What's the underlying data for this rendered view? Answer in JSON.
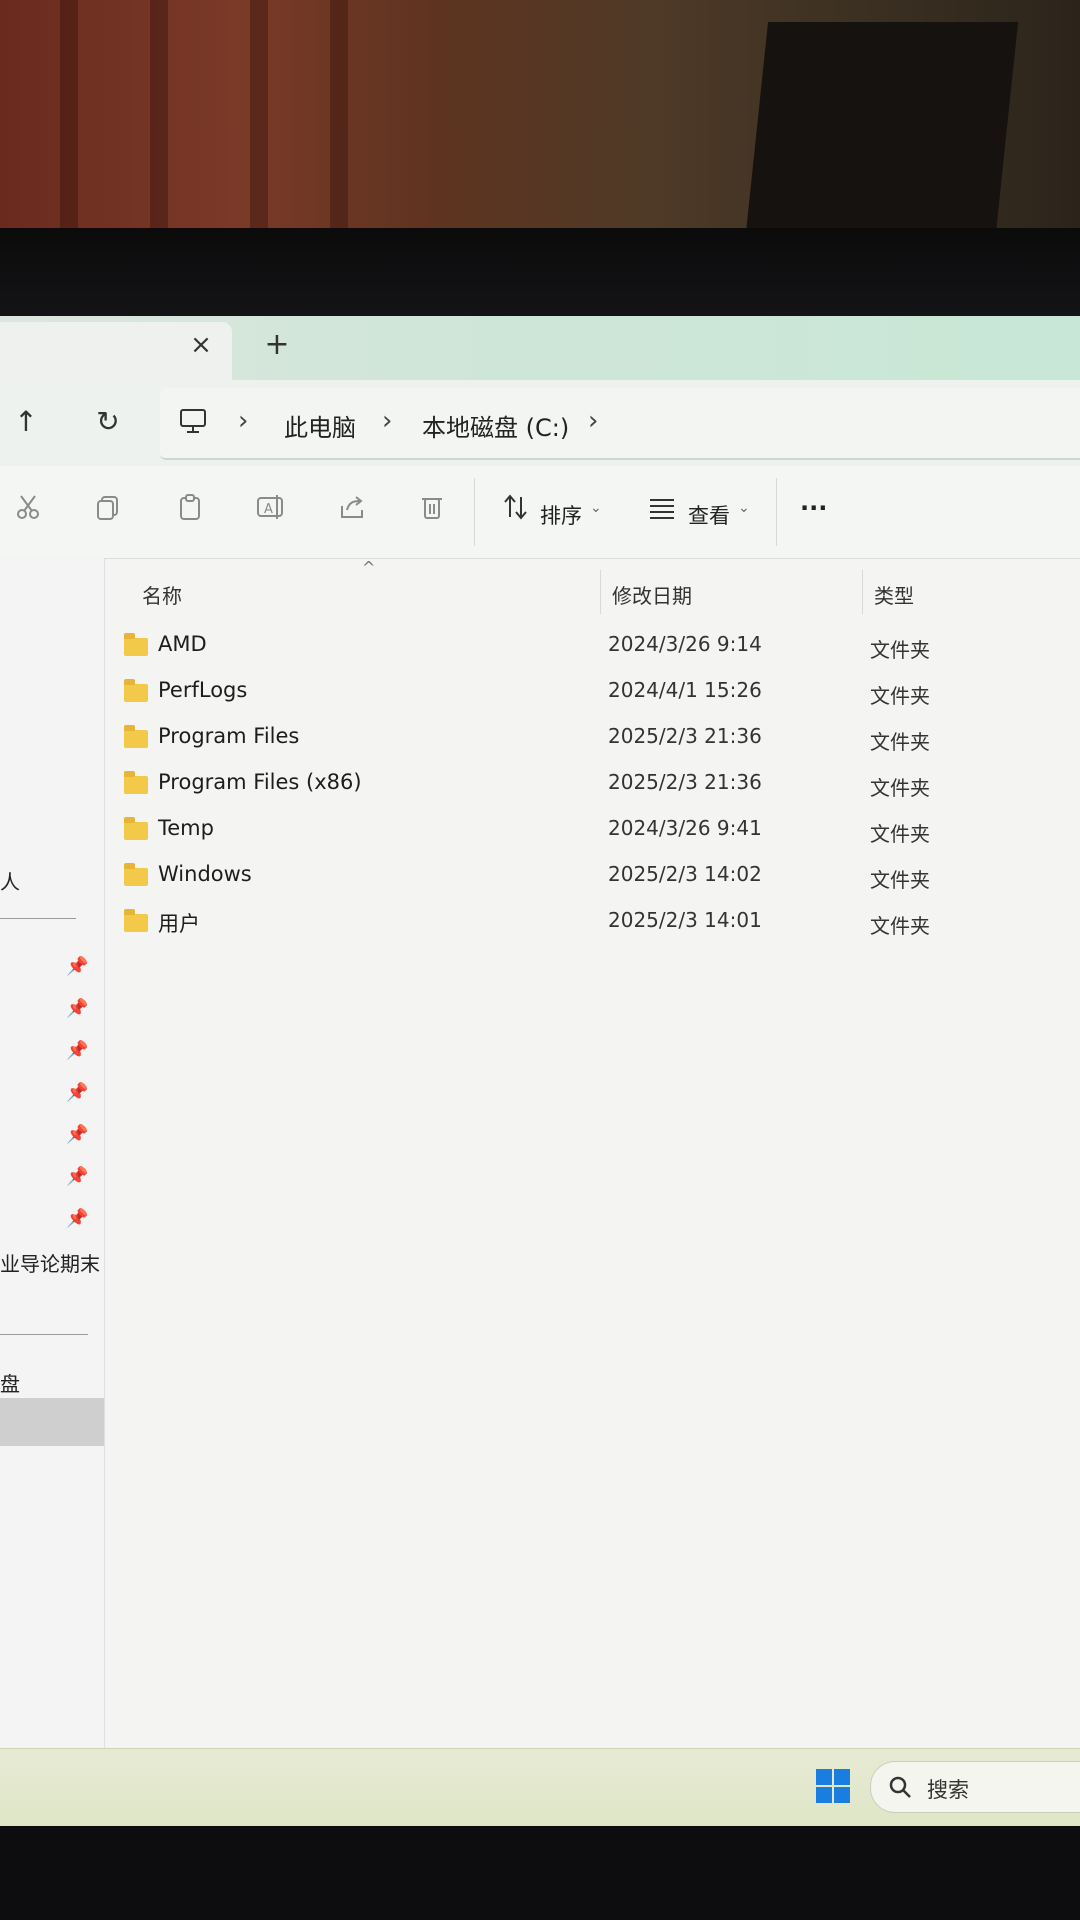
{
  "tabs": {
    "close_glyph": "×",
    "new_glyph": "+"
  },
  "nav": {
    "up_glyph": "↑",
    "refresh_glyph": "↻",
    "breadcrumbs": [
      "此电脑",
      "本地磁盘 (C:)"
    ],
    "separator": "›"
  },
  "toolbar": {
    "sort_label": "排序",
    "view_label": "查看",
    "more_label": "···",
    "caret": "⌄"
  },
  "sidebar": {
    "items": [
      "人",
      "业导论期末试",
      "盘"
    ]
  },
  "columns": {
    "name": "名称",
    "modified": "修改日期",
    "type": "类型"
  },
  "files": [
    {
      "name": "AMD",
      "modified": "2024/3/26 9:14",
      "type": "文件夹"
    },
    {
      "name": "PerfLogs",
      "modified": "2024/4/1 15:26",
      "type": "文件夹"
    },
    {
      "name": "Program Files",
      "modified": "2025/2/3 21:36",
      "type": "文件夹"
    },
    {
      "name": "Program Files (x86)",
      "modified": "2025/2/3 21:36",
      "type": "文件夹"
    },
    {
      "name": "Temp",
      "modified": "2024/3/26 9:41",
      "type": "文件夹"
    },
    {
      "name": "Windows",
      "modified": "2025/2/3 14:02",
      "type": "文件夹"
    },
    {
      "name": "用户",
      "modified": "2025/2/3 14:01",
      "type": "文件夹"
    }
  ],
  "taskbar": {
    "search_label": "搜索"
  },
  "colors": {
    "accent": "#1a7de0",
    "folder": "#f3c94a",
    "tabbar": "#c8e7d6"
  }
}
